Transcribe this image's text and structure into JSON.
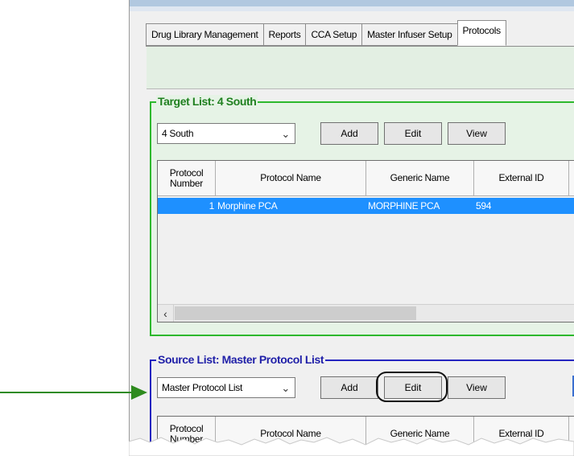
{
  "tabs": [
    {
      "label": "Drug Library Management",
      "active": false
    },
    {
      "label": "Reports",
      "active": false
    },
    {
      "label": "CCA Setup",
      "active": false
    },
    {
      "label": "Master Infuser Setup",
      "active": false
    },
    {
      "label": "Protocols",
      "active": true
    }
  ],
  "target": {
    "title": "Target List: 4 South",
    "combo_value": "4 South",
    "add_label": "Add",
    "edit_label": "Edit",
    "view_label": "View",
    "columns": [
      "Protocol Number",
      "Protocol Name",
      "Generic Name",
      "External ID"
    ],
    "rows": [
      {
        "number": "1",
        "name": "Morphine PCA",
        "generic": "MORPHINE PCA",
        "external_id": "594"
      }
    ]
  },
  "source": {
    "title": "Source List: Master Protocol List",
    "combo_value": "Master Protocol List",
    "add_label": "Add",
    "edit_label": "Edit",
    "view_label": "View",
    "columns": [
      "Protocol Number",
      "Protocol Name",
      "Generic Name",
      "External ID"
    ]
  },
  "colors": {
    "target_border": "#2db82d",
    "source_border": "#2525c0",
    "selection": "#1e90ff",
    "arrow": "#2e8b1e"
  },
  "icons": {
    "dropdown": "chevron-down-icon",
    "scroll_left": "chevron-left-icon",
    "pointer": "arrow-right-icon"
  }
}
